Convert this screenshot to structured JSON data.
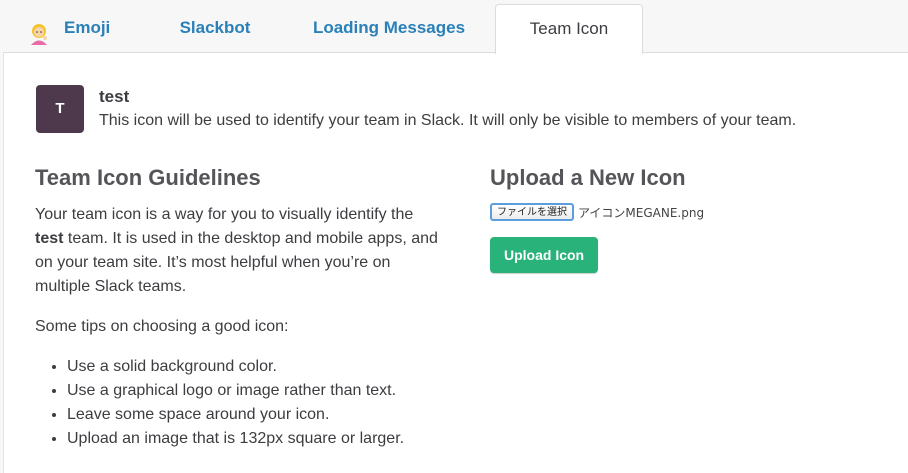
{
  "tabs": {
    "emoji": "Emoji",
    "slackbot": "Slackbot",
    "loading": "Loading Messages",
    "team_icon": "Team Icon"
  },
  "team": {
    "avatar_letter": "T",
    "avatar_color": "#4d394b",
    "name": "test",
    "description": "This icon will be used to identify your team in Slack. It will only be visible to members of your team."
  },
  "guidelines": {
    "title": "Team Icon Guidelines",
    "p1_before": "Your team icon is a way for you to visually identify the ",
    "p1_team": "test",
    "p1_after": " team. It is used in the desktop and mobile apps, and on your team site. It’s most helpful when you’re on multiple Slack teams.",
    "p2": "Some tips on choosing a good icon:",
    "tips": [
      "Use a solid background color.",
      "Use a graphical logo or image rather than text.",
      "Leave some space around your icon.",
      "Upload an image that is 132px square or larger."
    ]
  },
  "upload": {
    "title": "Upload a New Icon",
    "file_button": "ファイルを選択",
    "file_name": "アイコンMEGANE.png",
    "button_label": "Upload Icon",
    "button_color": "#2ab27b"
  }
}
